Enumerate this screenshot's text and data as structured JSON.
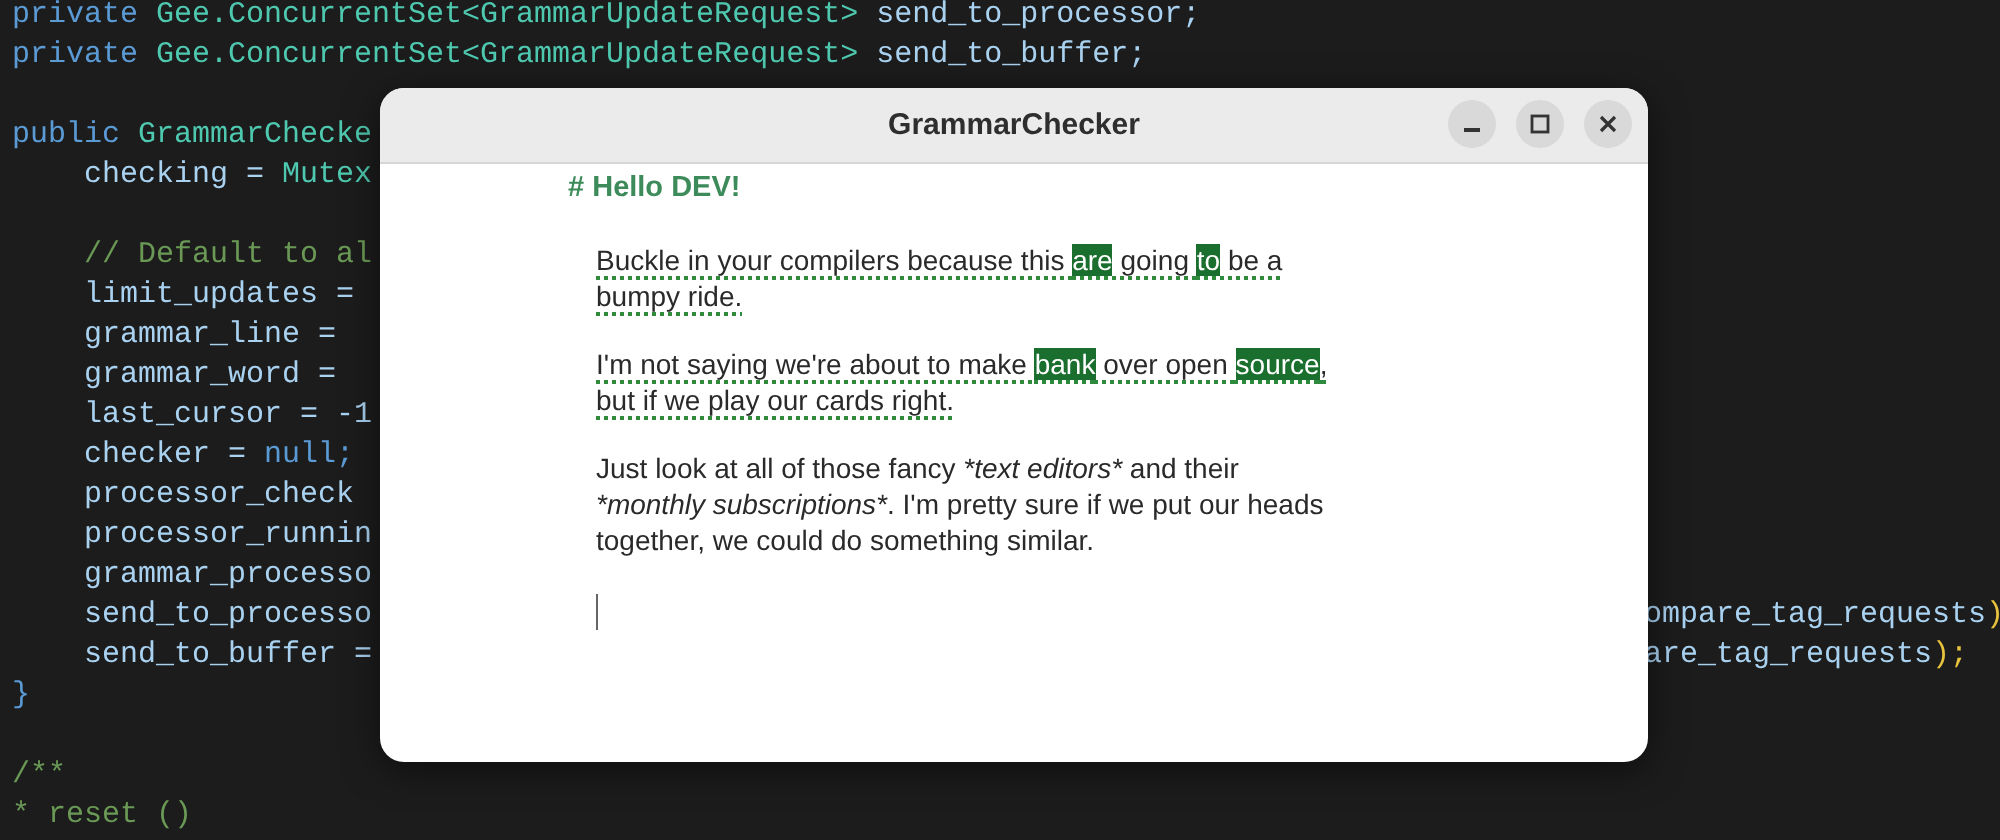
{
  "editor": {
    "blocks": [
      {
        "lines": [
          {
            "segments": [
              {
                "text": "private ",
                "kind": "keyword"
              },
              {
                "text": "Gee.ConcurrentSet<GrammarUpdateRequest>",
                "kind": "type"
              },
              {
                "text": " send_to_processor;",
                "kind": "name"
              }
            ]
          },
          {
            "segments": [
              {
                "text": "private ",
                "kind": "keyword"
              },
              {
                "text": "Gee.ConcurrentSet<GrammarUpdateRequest>",
                "kind": "type"
              },
              {
                "text": " send_to_buffer;",
                "kind": "name"
              }
            ]
          }
        ]
      },
      {
        "lines": [
          {
            "segments": [
              {
                "text": "public ",
                "kind": "keyword"
              },
              {
                "text": "GrammarChecke",
                "kind": "type"
              }
            ]
          },
          {
            "segments": [
              {
                "text": "    checking = ",
                "kind": "name"
              },
              {
                "text": "Mutex",
                "kind": "type"
              }
            ]
          }
        ]
      },
      {
        "lines": [
          {
            "segments": [
              {
                "text": "    // Default to al",
                "kind": "comment"
              }
            ]
          },
          {
            "segments": [
              {
                "text": "    limit_updates =",
                "kind": "name"
              }
            ]
          },
          {
            "segments": [
              {
                "text": "    grammar_line =",
                "kind": "name"
              }
            ]
          },
          {
            "segments": [
              {
                "text": "    grammar_word =",
                "kind": "name"
              }
            ]
          },
          {
            "segments": [
              {
                "text": "    last_cursor = -1",
                "kind": "name"
              }
            ]
          },
          {
            "segments": [
              {
                "text": "    checker = ",
                "kind": "name"
              },
              {
                "text": "null;",
                "kind": "keyword"
              }
            ]
          },
          {
            "segments": [
              {
                "text": "    processor_check",
                "kind": "name"
              }
            ]
          },
          {
            "segments": [
              {
                "text": "    processor_runnin",
                "kind": "name"
              }
            ]
          },
          {
            "segments": [
              {
                "text": "    grammar_processo",
                "kind": "name"
              }
            ]
          },
          {
            "segments": [
              {
                "text": "    send_to_processo",
                "kind": "name"
              }
            ],
            "right": [
              {
                "text": "ompare_tag_requests",
                "kind": "name"
              },
              {
                "text": ")",
                "kind": "bracket"
              }
            ]
          },
          {
            "segments": [
              {
                "text": "    send_to_buffer =",
                "kind": "name"
              }
            ],
            "right": [
              {
                "text": "are_tag_requests",
                "kind": "name"
              },
              {
                "text": ");",
                "kind": "bracket"
              }
            ]
          },
          {
            "segments": [
              {
                "text": "}",
                "kind": "keyword"
              }
            ]
          }
        ]
      },
      {
        "lines": [
          {
            "segments": [
              {
                "text": "/**",
                "kind": "comment"
              }
            ]
          },
          {
            "segments": [
              {
                "text": "* reset ()",
                "kind": "comment"
              }
            ]
          }
        ]
      }
    ]
  },
  "window": {
    "title": "GrammarChecker",
    "heading": "# Hello DEV!",
    "paragraphs": [
      {
        "flagged": true,
        "lines": [
          [
            {
              "text": "Buckle in your compilers because this ",
              "highlighted": false
            },
            {
              "text": "are",
              "highlighted": true
            },
            {
              "text": " going ",
              "highlighted": false
            },
            {
              "text": "to",
              "highlighted": true
            },
            {
              "text": " be a",
              "highlighted": false
            }
          ],
          [
            {
              "text": "bumpy ride.",
              "highlighted": false
            }
          ]
        ]
      },
      {
        "flagged": true,
        "lines": [
          [
            {
              "text": "I'm not saying we're about to make ",
              "highlighted": false
            },
            {
              "text": "bank",
              "highlighted": true
            },
            {
              "text": " over open ",
              "highlighted": false
            },
            {
              "text": "source",
              "highlighted": true
            },
            {
              "text": ",",
              "highlighted": false
            }
          ],
          [
            {
              "text": "but if we play our cards right.",
              "highlighted": false
            }
          ]
        ]
      },
      {
        "flagged": false,
        "lines": [
          [
            {
              "text": "Just look at all of those fancy ",
              "italic": false
            },
            {
              "text": "*text editors*",
              "italic": true
            },
            {
              "text": " and their",
              "italic": false
            }
          ],
          [
            {
              "text": "*monthly subscriptions*",
              "italic": true
            },
            {
              "text": ". I'm pretty sure if we put our heads",
              "italic": false
            }
          ],
          [
            {
              "text": "together, we could do something similar.",
              "italic": false
            }
          ]
        ]
      }
    ]
  }
}
